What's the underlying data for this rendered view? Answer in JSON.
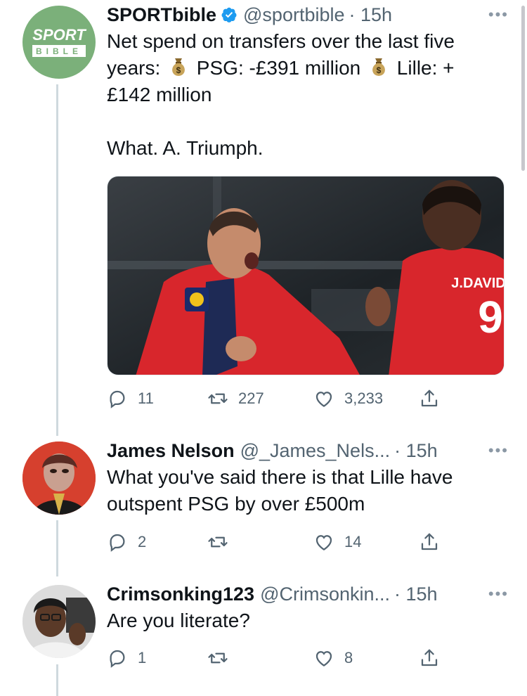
{
  "tweet": {
    "name": "SPORTbible",
    "handle": "@sportbible",
    "time": "· 15h",
    "avatar_text_top": "SPORT",
    "avatar_text_bottom": "BIBLE",
    "text_line1": "Net spend on transfers over the last five",
    "text_line2a": "years: ",
    "text_line2b": " PSG: -£391 million ",
    "text_line2c": " Lille: +",
    "text_line3": "£142 million",
    "text_line4": "What. A. Triumph.",
    "media": {
      "jersey_name": "J.DAVID",
      "jersey_number": "9"
    },
    "replies": "11",
    "retweets": "227",
    "likes": "3,233"
  },
  "reply1": {
    "name": "James Nelson",
    "handle": "@_James_Nels...",
    "time": "· 15h",
    "text_line1": "What you've said there is that Lille have",
    "text_line2": "outspent PSG by over £500m",
    "replies": "2",
    "retweets": "",
    "likes": "14"
  },
  "reply2": {
    "name": "Crimsonking123",
    "handle": "@Crimsonkin...",
    "time": "· 15h",
    "text_line1": "Are you literate?",
    "replies": "1",
    "retweets": "",
    "likes": "8"
  },
  "more_label": "•••",
  "colors": {
    "avatar_green": "#7bb07a",
    "verified_blue": "#1d9bf0",
    "muted": "#536471",
    "thread_line": "#cfd9de",
    "jersey_red": "#d8262c"
  }
}
